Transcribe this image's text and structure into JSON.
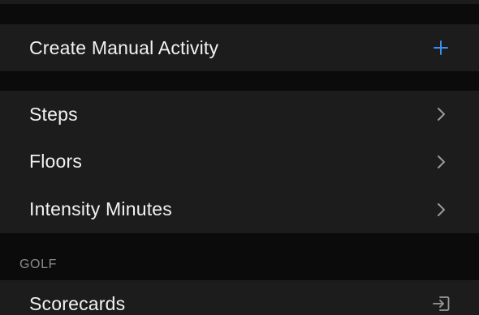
{
  "create_section": {
    "label": "Create Manual Activity",
    "action_icon": "plus-icon",
    "accent_color": "#3d8fe8"
  },
  "activity_section": {
    "items": [
      {
        "label": "Steps",
        "icon": "chevron-right-icon"
      },
      {
        "label": "Floors",
        "icon": "chevron-right-icon"
      },
      {
        "label": "Intensity Minutes",
        "icon": "chevron-right-icon"
      }
    ]
  },
  "golf_section": {
    "header": "GOLF",
    "items": [
      {
        "label": "Scorecards",
        "icon": "import-icon"
      }
    ]
  },
  "colors": {
    "background": "#0b0b0b",
    "card": "#1c1c1c",
    "text": "#f2f2f2",
    "secondary_text": "#8a8a8a",
    "chevron": "#9a9a9a"
  }
}
